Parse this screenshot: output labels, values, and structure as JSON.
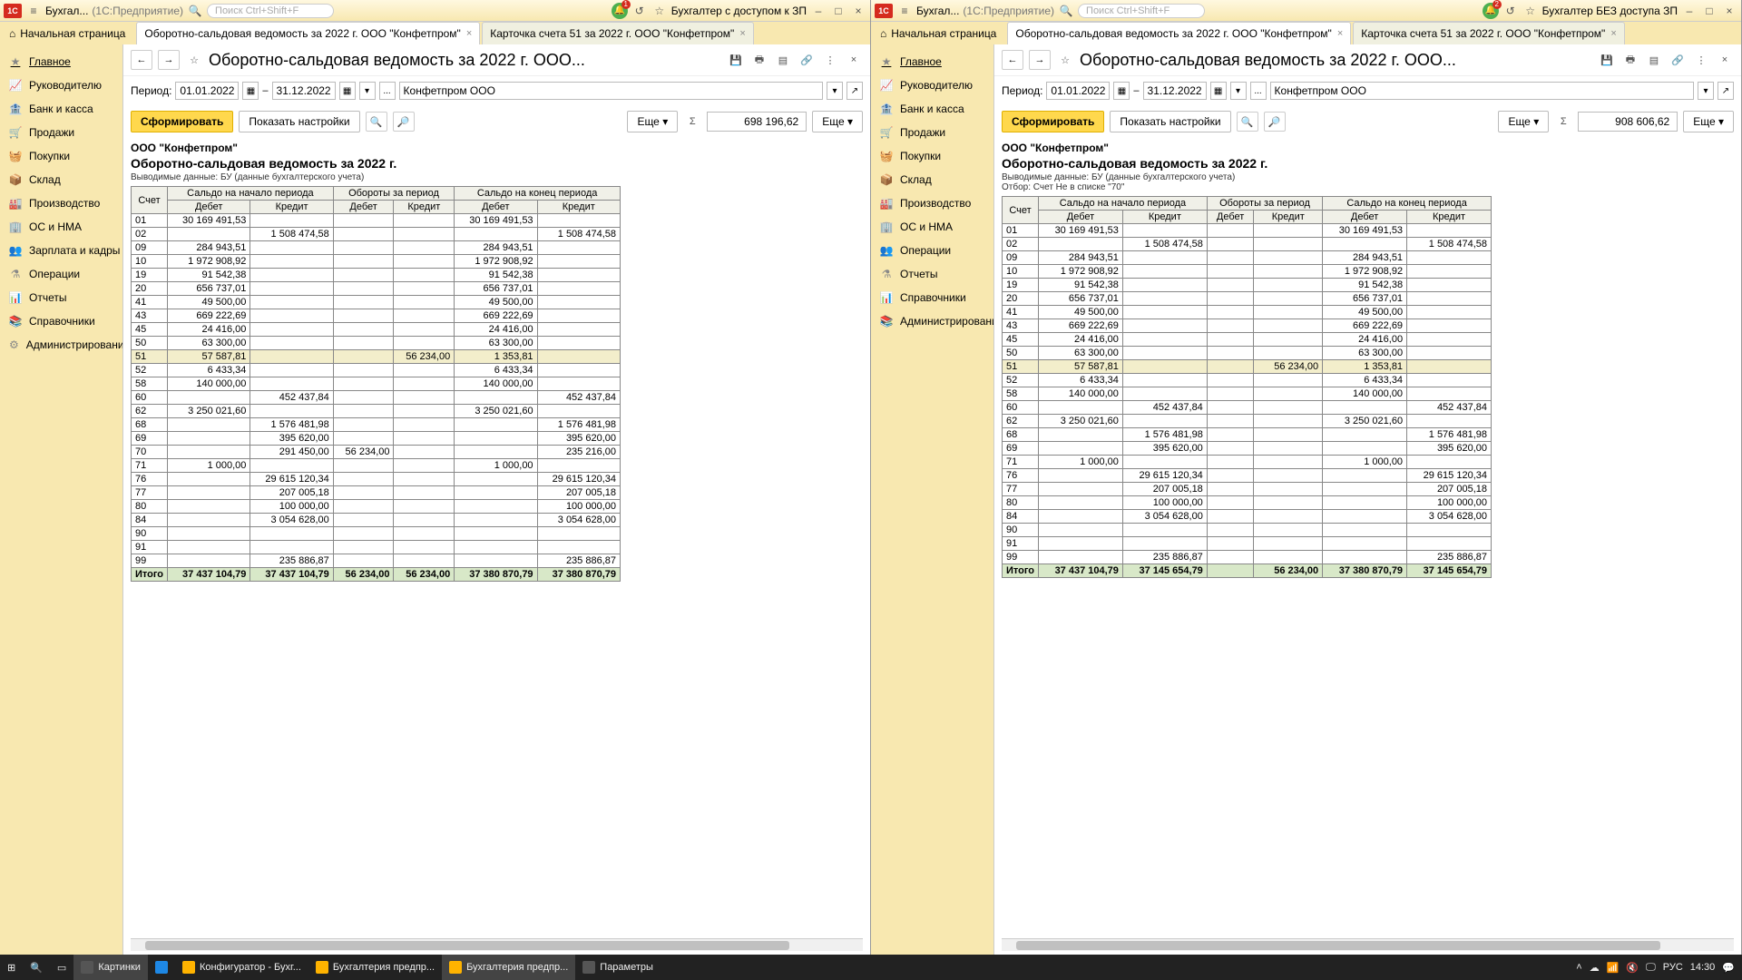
{
  "left": {
    "titlebar": {
      "app": "Бухгал...",
      "sub": "(1С:Предприятие)",
      "search_ph": "Поиск Ctrl+Shift+F",
      "user": "Бухгалтер с доступом к ЗП",
      "badge": "1"
    },
    "tabs": {
      "home": "Начальная страница",
      "t1": "Оборотно-сальдовая ведомость за 2022 г. ООО \"Конфетпром\"",
      "t2": "Карточка счета 51 за 2022 г. ООО \"Конфетпром\""
    },
    "sidebar": [
      "Главное",
      "Руководителю",
      "Банк и касса",
      "Продажи",
      "Покупки",
      "Склад",
      "Производство",
      "ОС и НМА",
      "Зарплата и кадры",
      "Операции",
      "Отчеты",
      "Справочники",
      "Администрирование"
    ],
    "header": "Оборотно-сальдовая ведомость за 2022 г. ООО...",
    "period_label": "Период:",
    "from": "01.01.2022",
    "to": "31.12.2022",
    "org": "Конфетпром ООО",
    "btn_form": "Сформировать",
    "btn_settings": "Показать настройки",
    "btn_more": "Еще",
    "total": "698 196,62",
    "rep": {
      "org": "ООО \"Конфетпром\"",
      "title": "Оборотно-сальдовая ведомость за 2022 г.",
      "meta": "Выводимые данные: БУ (данные бухгалтерского учета)",
      "filter": ""
    },
    "cols": {
      "acc": "Счет",
      "g1": "Сальдо на начало периода",
      "g2": "Обороты за период",
      "g3": "Сальдо на конец периода",
      "d": "Дебет",
      "k": "Кредит"
    },
    "rows": [
      {
        "a": "01",
        "sd": "30 169 491,53",
        "sk": "",
        "od": "",
        "ok": "",
        "ed": "30 169 491,53",
        "ek": ""
      },
      {
        "a": "02",
        "sd": "",
        "sk": "1 508 474,58",
        "od": "",
        "ok": "",
        "ed": "",
        "ek": "1 508 474,58"
      },
      {
        "a": "09",
        "sd": "284 943,51",
        "sk": "",
        "od": "",
        "ok": "",
        "ed": "284 943,51",
        "ek": ""
      },
      {
        "a": "10",
        "sd": "1 972 908,92",
        "sk": "",
        "od": "",
        "ok": "",
        "ed": "1 972 908,92",
        "ek": ""
      },
      {
        "a": "19",
        "sd": "91 542,38",
        "sk": "",
        "od": "",
        "ok": "",
        "ed": "91 542,38",
        "ek": ""
      },
      {
        "a": "20",
        "sd": "656 737,01",
        "sk": "",
        "od": "",
        "ok": "",
        "ed": "656 737,01",
        "ek": ""
      },
      {
        "a": "41",
        "sd": "49 500,00",
        "sk": "",
        "od": "",
        "ok": "",
        "ed": "49 500,00",
        "ek": ""
      },
      {
        "a": "43",
        "sd": "669 222,69",
        "sk": "",
        "od": "",
        "ok": "",
        "ed": "669 222,69",
        "ek": ""
      },
      {
        "a": "45",
        "sd": "24 416,00",
        "sk": "",
        "od": "",
        "ok": "",
        "ed": "24 416,00",
        "ek": ""
      },
      {
        "a": "50",
        "sd": "63 300,00",
        "sk": "",
        "od": "",
        "ok": "",
        "ed": "63 300,00",
        "ek": ""
      },
      {
        "a": "51",
        "sd": "57 587,81",
        "sk": "",
        "od": "",
        "ok": "56 234,00",
        "ed": "1 353,81",
        "ek": "",
        "hl": true
      },
      {
        "a": "52",
        "sd": "6 433,34",
        "sk": "",
        "od": "",
        "ok": "",
        "ed": "6 433,34",
        "ek": ""
      },
      {
        "a": "58",
        "sd": "140 000,00",
        "sk": "",
        "od": "",
        "ok": "",
        "ed": "140 000,00",
        "ek": ""
      },
      {
        "a": "60",
        "sd": "",
        "sk": "452 437,84",
        "od": "",
        "ok": "",
        "ed": "",
        "ek": "452 437,84"
      },
      {
        "a": "62",
        "sd": "3 250 021,60",
        "sk": "",
        "od": "",
        "ok": "",
        "ed": "3 250 021,60",
        "ek": ""
      },
      {
        "a": "68",
        "sd": "",
        "sk": "1 576 481,98",
        "od": "",
        "ok": "",
        "ed": "",
        "ek": "1 576 481,98"
      },
      {
        "a": "69",
        "sd": "",
        "sk": "395 620,00",
        "od": "",
        "ok": "",
        "ed": "",
        "ek": "395 620,00"
      },
      {
        "a": "70",
        "sd": "",
        "sk": "291 450,00",
        "od": "56 234,00",
        "ok": "",
        "ed": "",
        "ek": "235 216,00"
      },
      {
        "a": "71",
        "sd": "1 000,00",
        "sk": "",
        "od": "",
        "ok": "",
        "ed": "1 000,00",
        "ek": ""
      },
      {
        "a": "76",
        "sd": "",
        "sk": "29 615 120,34",
        "od": "",
        "ok": "",
        "ed": "",
        "ek": "29 615 120,34"
      },
      {
        "a": "77",
        "sd": "",
        "sk": "207 005,18",
        "od": "",
        "ok": "",
        "ed": "",
        "ek": "207 005,18"
      },
      {
        "a": "80",
        "sd": "",
        "sk": "100 000,00",
        "od": "",
        "ok": "",
        "ed": "",
        "ek": "100 000,00"
      },
      {
        "a": "84",
        "sd": "",
        "sk": "3 054 628,00",
        "od": "",
        "ok": "",
        "ed": "",
        "ek": "3 054 628,00"
      },
      {
        "a": "90",
        "sd": "",
        "sk": "",
        "od": "",
        "ok": "",
        "ed": "",
        "ek": ""
      },
      {
        "a": "91",
        "sd": "",
        "sk": "",
        "od": "",
        "ok": "",
        "ed": "",
        "ek": ""
      },
      {
        "a": "99",
        "sd": "",
        "sk": "235 886,87",
        "od": "",
        "ok": "",
        "ed": "",
        "ek": "235 886,87"
      }
    ],
    "totals": {
      "label": "Итого",
      "sd": "37 437 104,79",
      "sk": "37 437 104,79",
      "od": "56 234,00",
      "ok": "56 234,00",
      "ed": "37 380 870,79",
      "ek": "37 380 870,79"
    }
  },
  "right": {
    "titlebar": {
      "app": "Бухгал...",
      "sub": "(1С:Предприятие)",
      "search_ph": "Поиск Ctrl+Shift+F",
      "user": "Бухгалтер БЕЗ доступа ЗП",
      "badge": "2"
    },
    "tabs": {
      "home": "Начальная страница",
      "t1": "Оборотно-сальдовая ведомость за 2022 г. ООО \"Конфетпром\"",
      "t2": "Карточка счета 51 за 2022 г. ООО \"Конфетпром\""
    },
    "sidebar": [
      "Главное",
      "Руководителю",
      "Банк и касса",
      "Продажи",
      "Покупки",
      "Склад",
      "Производство",
      "ОС и НМА",
      "Операции",
      "Отчеты",
      "Справочники",
      "Администрирование"
    ],
    "header": "Оборотно-сальдовая ведомость за 2022 г. ООО...",
    "period_label": "Период:",
    "from": "01.01.2022",
    "to": "31.12.2022",
    "org": "Конфетпром ООО",
    "btn_form": "Сформировать",
    "btn_settings": "Показать настройки",
    "btn_more": "Еще",
    "total": "908 606,62",
    "rep": {
      "org": "ООО \"Конфетпром\"",
      "title": "Оборотно-сальдовая ведомость за 2022 г.",
      "meta": "Выводимые данные: БУ (данные бухгалтерского учета)",
      "filter": "Отбор: Счет Не в списке \"70\""
    },
    "cols": {
      "acc": "Счет",
      "g1": "Сальдо на начало периода",
      "g2": "Обороты за период",
      "g3": "Сальдо на конец периода",
      "d": "Дебет",
      "k": "Кредит"
    },
    "rows": [
      {
        "a": "01",
        "sd": "30 169 491,53",
        "sk": "",
        "od": "",
        "ok": "",
        "ed": "30 169 491,53",
        "ek": ""
      },
      {
        "a": "02",
        "sd": "",
        "sk": "1 508 474,58",
        "od": "",
        "ok": "",
        "ed": "",
        "ek": "1 508 474,58"
      },
      {
        "a": "09",
        "sd": "284 943,51",
        "sk": "",
        "od": "",
        "ok": "",
        "ed": "284 943,51",
        "ek": ""
      },
      {
        "a": "10",
        "sd": "1 972 908,92",
        "sk": "",
        "od": "",
        "ok": "",
        "ed": "1 972 908,92",
        "ek": ""
      },
      {
        "a": "19",
        "sd": "91 542,38",
        "sk": "",
        "od": "",
        "ok": "",
        "ed": "91 542,38",
        "ek": ""
      },
      {
        "a": "20",
        "sd": "656 737,01",
        "sk": "",
        "od": "",
        "ok": "",
        "ed": "656 737,01",
        "ek": ""
      },
      {
        "a": "41",
        "sd": "49 500,00",
        "sk": "",
        "od": "",
        "ok": "",
        "ed": "49 500,00",
        "ek": ""
      },
      {
        "a": "43",
        "sd": "669 222,69",
        "sk": "",
        "od": "",
        "ok": "",
        "ed": "669 222,69",
        "ek": ""
      },
      {
        "a": "45",
        "sd": "24 416,00",
        "sk": "",
        "od": "",
        "ok": "",
        "ed": "24 416,00",
        "ek": ""
      },
      {
        "a": "50",
        "sd": "63 300,00",
        "sk": "",
        "od": "",
        "ok": "",
        "ed": "63 300,00",
        "ek": ""
      },
      {
        "a": "51",
        "sd": "57 587,81",
        "sk": "",
        "od": "",
        "ok": "56 234,00",
        "ed": "1 353,81",
        "ek": "",
        "hl": true
      },
      {
        "a": "52",
        "sd": "6 433,34",
        "sk": "",
        "od": "",
        "ok": "",
        "ed": "6 433,34",
        "ek": ""
      },
      {
        "a": "58",
        "sd": "140 000,00",
        "sk": "",
        "od": "",
        "ok": "",
        "ed": "140 000,00",
        "ek": ""
      },
      {
        "a": "60",
        "sd": "",
        "sk": "452 437,84",
        "od": "",
        "ok": "",
        "ed": "",
        "ek": "452 437,84"
      },
      {
        "a": "62",
        "sd": "3 250 021,60",
        "sk": "",
        "od": "",
        "ok": "",
        "ed": "3 250 021,60",
        "ek": ""
      },
      {
        "a": "68",
        "sd": "",
        "sk": "1 576 481,98",
        "od": "",
        "ok": "",
        "ed": "",
        "ek": "1 576 481,98"
      },
      {
        "a": "69",
        "sd": "",
        "sk": "395 620,00",
        "od": "",
        "ok": "",
        "ed": "",
        "ek": "395 620,00"
      },
      {
        "a": "71",
        "sd": "1 000,00",
        "sk": "",
        "od": "",
        "ok": "",
        "ed": "1 000,00",
        "ek": ""
      },
      {
        "a": "76",
        "sd": "",
        "sk": "29 615 120,34",
        "od": "",
        "ok": "",
        "ed": "",
        "ek": "29 615 120,34"
      },
      {
        "a": "77",
        "sd": "",
        "sk": "207 005,18",
        "od": "",
        "ok": "",
        "ed": "",
        "ek": "207 005,18"
      },
      {
        "a": "80",
        "sd": "",
        "sk": "100 000,00",
        "od": "",
        "ok": "",
        "ed": "",
        "ek": "100 000,00"
      },
      {
        "a": "84",
        "sd": "",
        "sk": "3 054 628,00",
        "od": "",
        "ok": "",
        "ed": "",
        "ek": "3 054 628,00"
      },
      {
        "a": "90",
        "sd": "",
        "sk": "",
        "od": "",
        "ok": "",
        "ed": "",
        "ek": ""
      },
      {
        "a": "91",
        "sd": "",
        "sk": "",
        "od": "",
        "ok": "",
        "ed": "",
        "ek": ""
      },
      {
        "a": "99",
        "sd": "",
        "sk": "235 886,87",
        "od": "",
        "ok": "",
        "ed": "",
        "ek": "235 886,87"
      }
    ],
    "totals": {
      "label": "Итого",
      "sd": "37 437 104,79",
      "sk": "37 145 654,79",
      "od": "",
      "ok": "56 234,00",
      "ed": "37 380 870,79",
      "ek": "37 145 654,79"
    }
  },
  "taskbar": {
    "items": [
      "Картинки",
      "",
      "Конфигуратор - Бухг...",
      "Бухгалтерия предпр...",
      "Бухгалтерия предпр...",
      "Параметры"
    ],
    "lang": "РУС",
    "time": "14:30"
  },
  "icons": {
    "home": "⌂",
    "menu": "≡",
    "history": "↺",
    "star": "☆",
    "min": "–",
    "max": "□",
    "close": "×",
    "back": "←",
    "fwd": "→",
    "save": "💾",
    "print": "🖶",
    "mail": "✉",
    "link": "🔗",
    "more": "⋮",
    "cal": "▦",
    "find": "🔍",
    "sum": "Σ",
    "gear": "⚙",
    "chart": "📊"
  }
}
